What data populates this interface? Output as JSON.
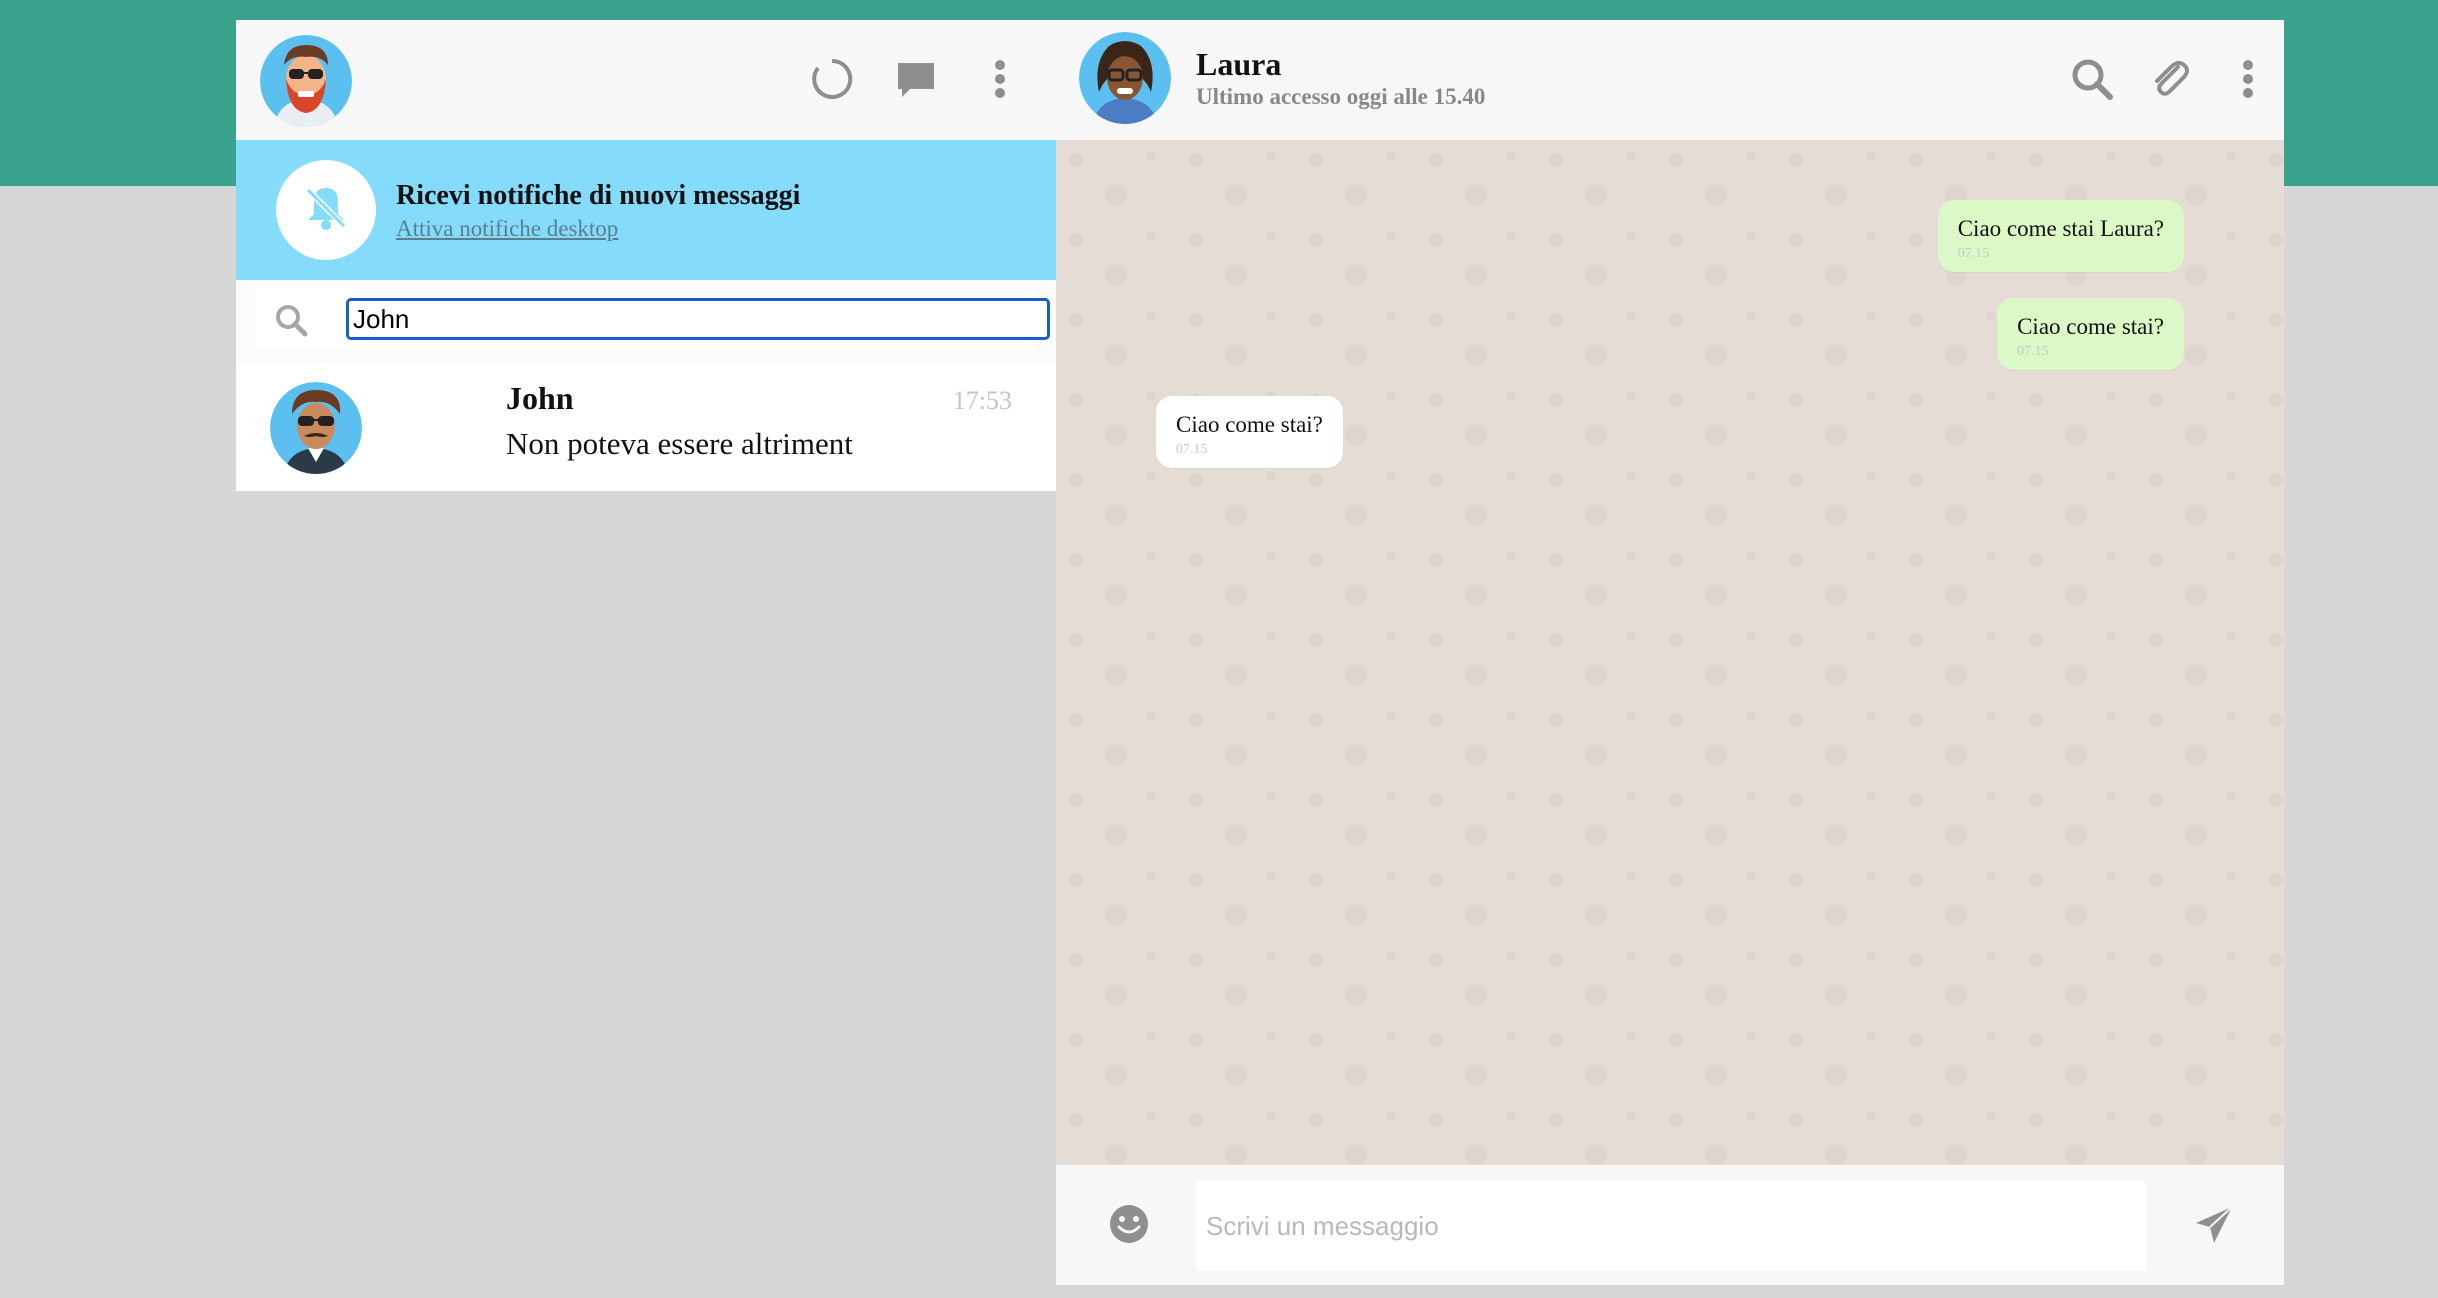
{
  "left_header": {
    "user_avatar": "bearded-man-sunglasses-avatar",
    "icons": [
      "status-icon",
      "new-chat-icon",
      "menu-dots-icon"
    ]
  },
  "notification": {
    "icon": "bell-off-icon",
    "title": "Ricevi notifiche di nuovi messaggi",
    "link": "Attiva notifiche desktop"
  },
  "search": {
    "value": "John",
    "icon": "search-icon"
  },
  "chats": [
    {
      "name": "John",
      "time": "17:53",
      "preview": "Non poteva essere altriment",
      "avatar": "man-sunglasses-mustache-avatar"
    }
  ],
  "conversation": {
    "contact_name": "Laura",
    "status": "Ultimo accesso oggi alle 15.40",
    "avatar": "woman-glasses-avatar",
    "icons": [
      "search-icon",
      "attach-icon",
      "menu-dots-icon"
    ]
  },
  "messages": [
    {
      "direction": "out",
      "text": "Ciao come stai Laura?",
      "time": "07.15"
    },
    {
      "direction": "out",
      "text": "Ciao come stai?",
      "time": "07.15"
    },
    {
      "direction": "in",
      "text": "Ciao come stai?",
      "time": "07.15"
    }
  ],
  "composer": {
    "placeholder": "Scrivi un messaggio",
    "emoji_icon": "emoji-icon",
    "send_icon": "send-icon"
  },
  "colors": {
    "top_band": "#3aa18c",
    "notification_bg": "#84dbfb",
    "outgoing_bubble": "#dcf8c6",
    "chat_bg": "#e5ddd5",
    "avatar_bg": "#5bc0f0"
  }
}
